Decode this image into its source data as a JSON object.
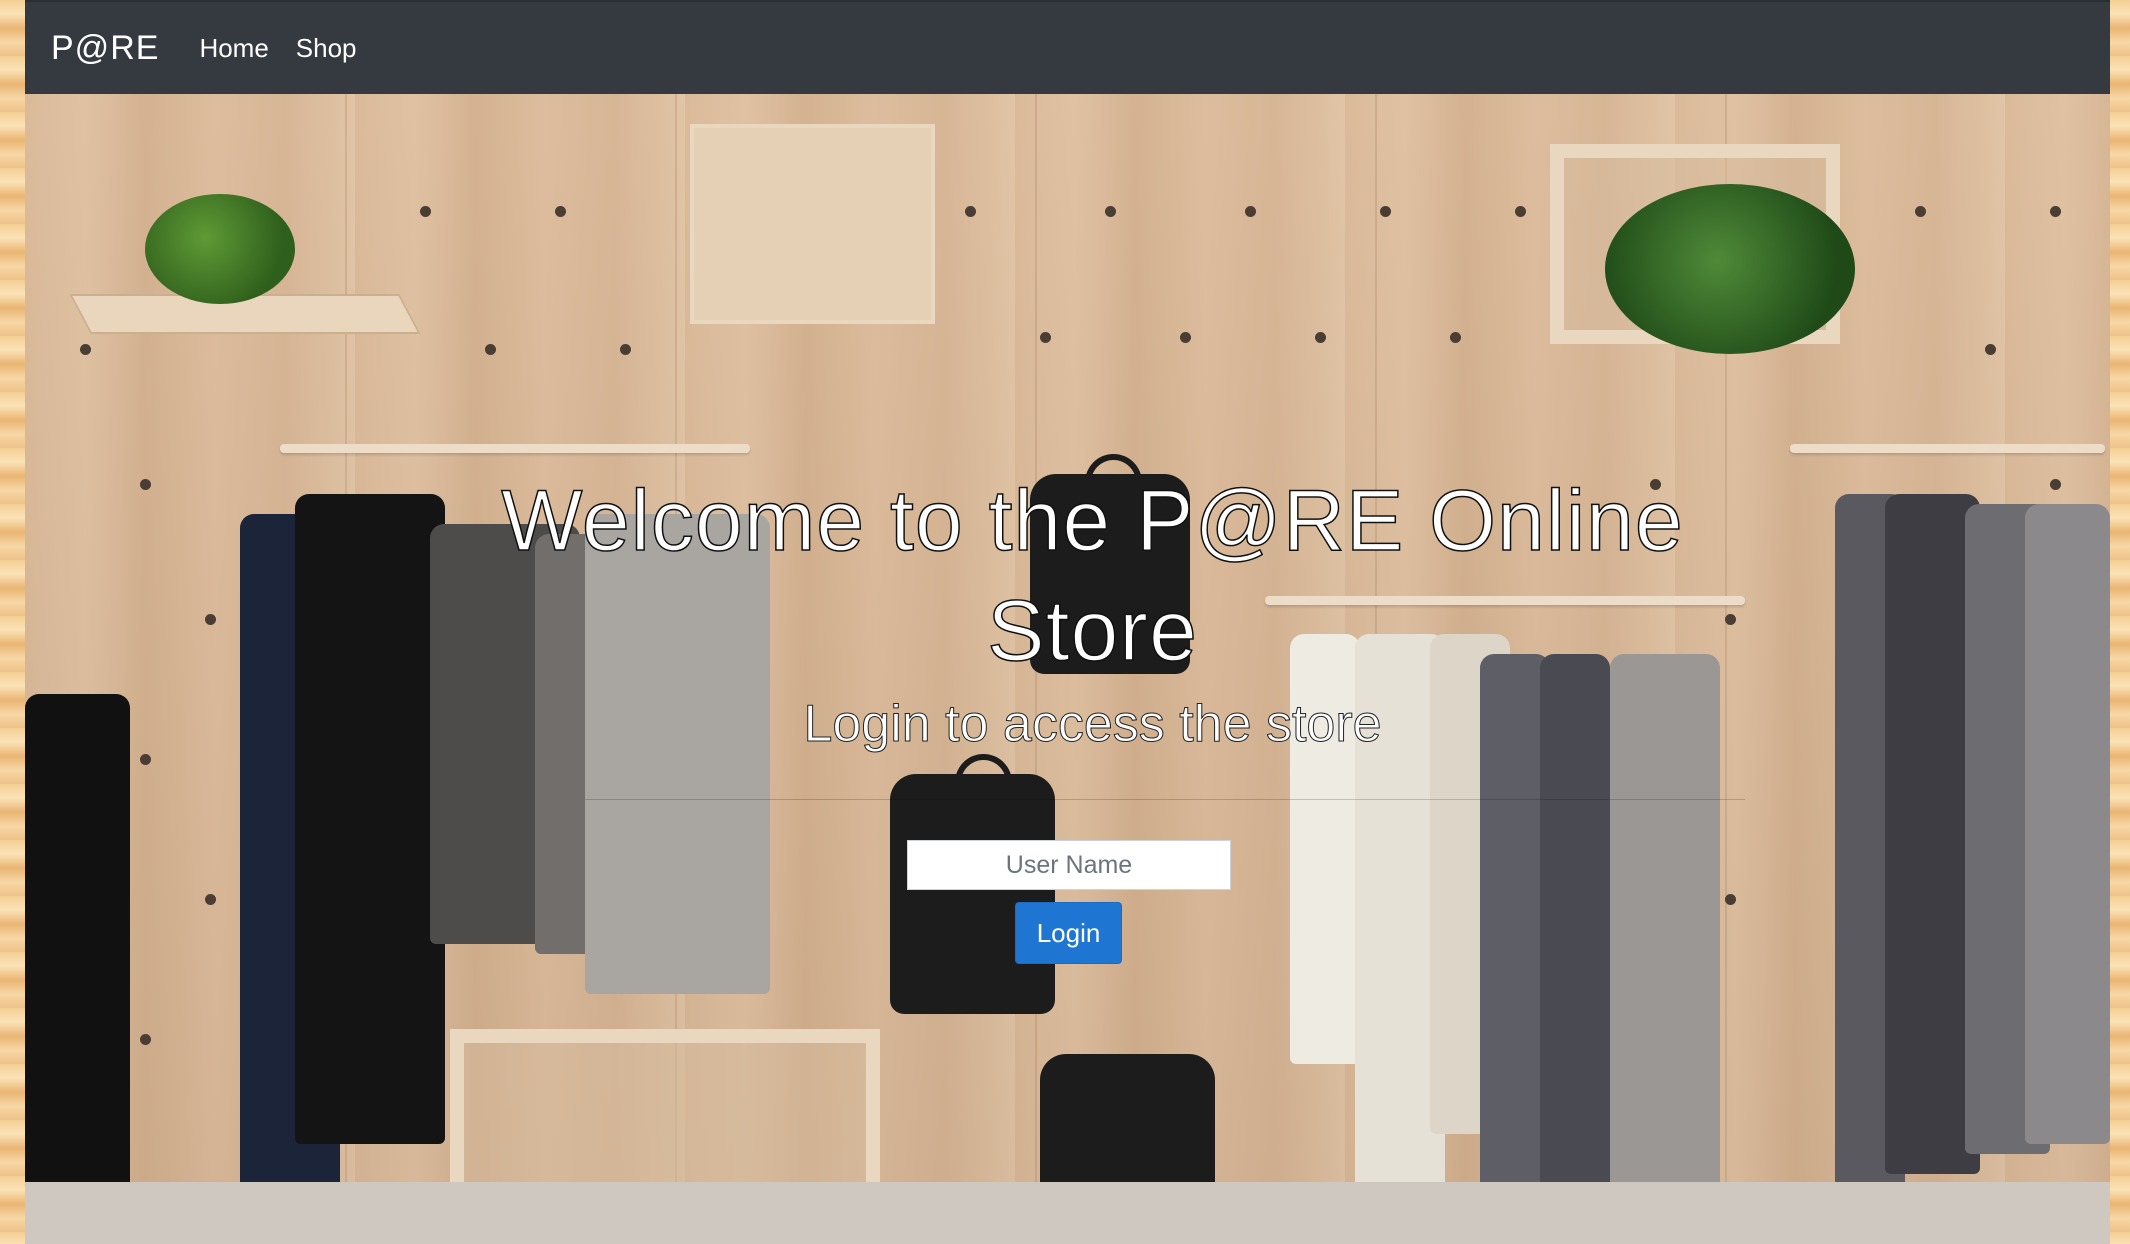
{
  "navbar": {
    "brand": "P@RE",
    "links": [
      {
        "label": "Home"
      },
      {
        "label": "Shop"
      }
    ],
    "background_color": "#343a40"
  },
  "hero": {
    "title": "Welcome to the P@RE Online Store",
    "subtitle": "Login to access the store",
    "background_image": "clothing-store-pegboard-wall"
  },
  "login_form": {
    "username_placeholder": "User Name",
    "username_value": "",
    "submit_label": "Login",
    "button_color": "#1f76d2"
  }
}
